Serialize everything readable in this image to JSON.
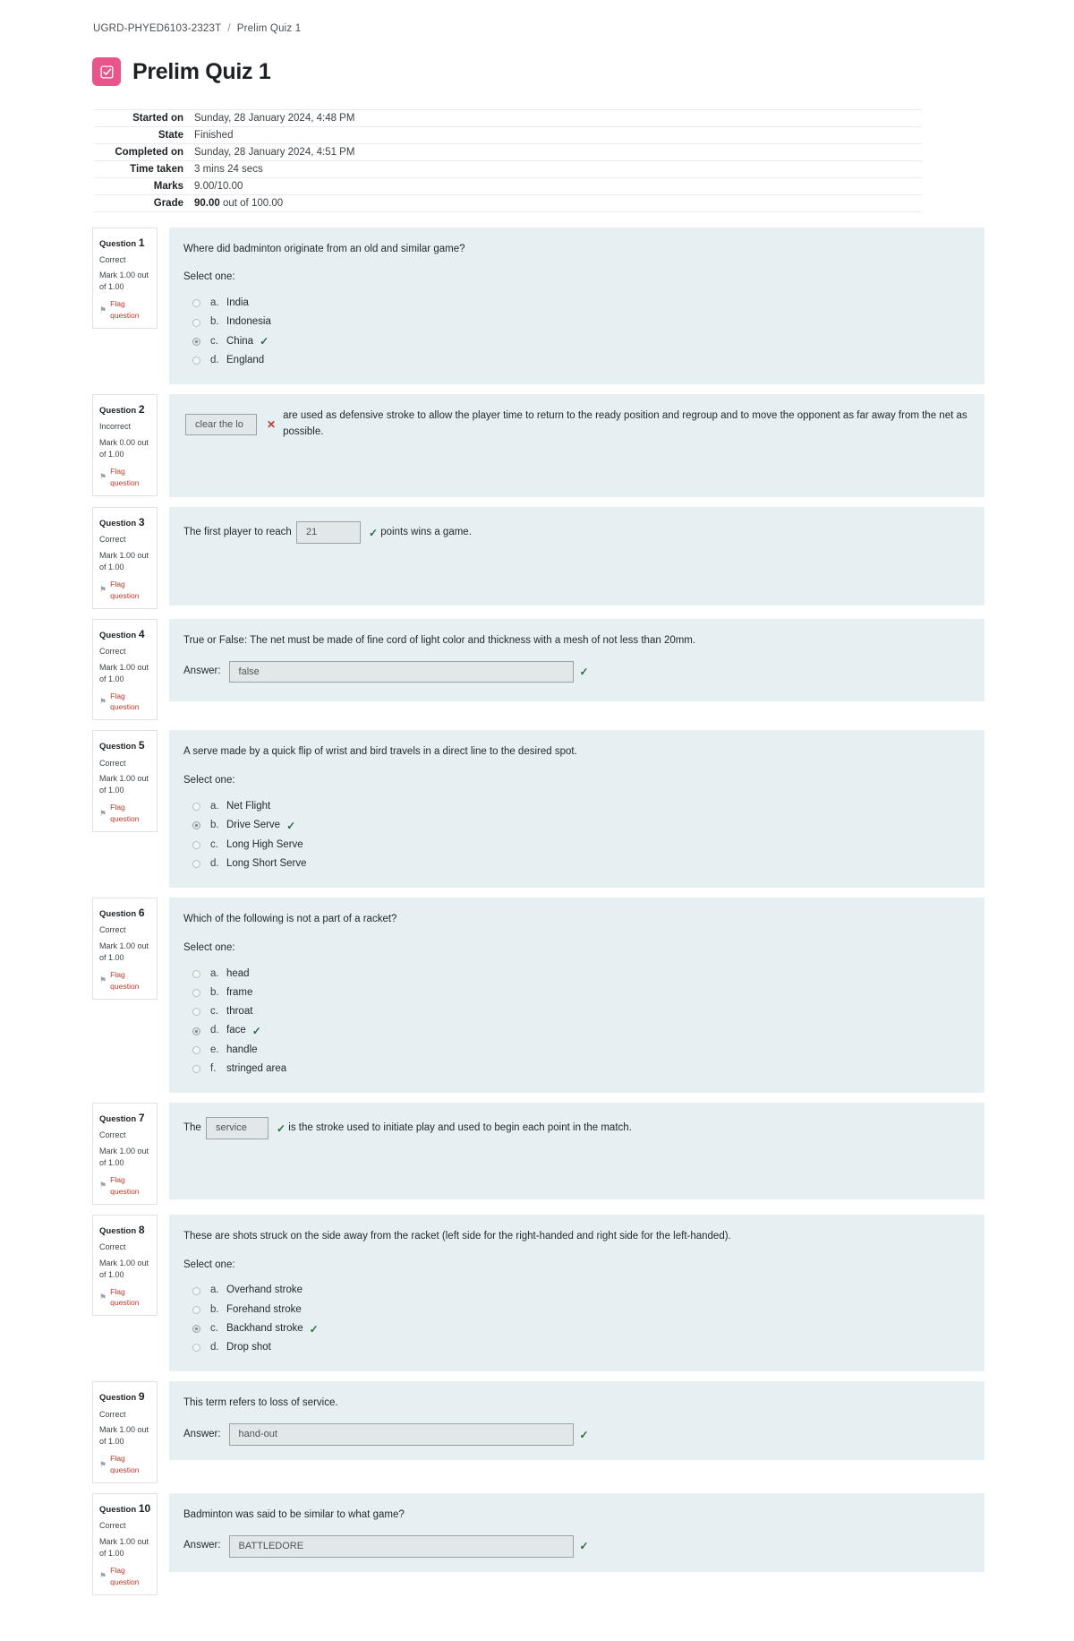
{
  "breadcrumb": {
    "course": "UGRD-PHYED6103-2323T",
    "separator": "/",
    "current": "Prelim Quiz 1"
  },
  "header": {
    "title": "Prelim Quiz 1",
    "icon": "quiz-checkbox-icon"
  },
  "summary": {
    "rows": [
      {
        "label": "Started on",
        "value": "Sunday, 28 January 2024, 4:48 PM"
      },
      {
        "label": "State",
        "value": "Finished"
      },
      {
        "label": "Completed on",
        "value": "Sunday, 28 January 2024, 4:51 PM"
      },
      {
        "label": "Time taken",
        "value": "3 mins 24 secs"
      },
      {
        "label": "Marks",
        "value": "9.00/10.00"
      }
    ],
    "grade": {
      "label": "Grade",
      "value": "90.00",
      "suffix": "out of 100.00"
    }
  },
  "labels": {
    "question_word": "Question",
    "select_one": "Select one:",
    "flag_question": "Flag question",
    "answer_label": "Answer:",
    "correct_mark": "✓",
    "incorrect_mark": "✕",
    "flag_icon": "⚑"
  },
  "colors": {
    "accent_pink": "#e9548c",
    "question_bg": "#e6f0f2",
    "correct_green": "#2e6b3f",
    "incorrect_red": "#c0392b",
    "flag_link": "#c0392b"
  },
  "questions": [
    {
      "number": "1",
      "state": "Correct",
      "mark": "Mark 1.00 out of 1.00",
      "type": "multichoice",
      "text": "Where did badminton originate from an old and similar game?",
      "options": [
        {
          "letter": "a.",
          "text": "India",
          "selected": false,
          "correct": false
        },
        {
          "letter": "b.",
          "text": "Indonesia",
          "selected": false,
          "correct": false
        },
        {
          "letter": "c.",
          "text": "China",
          "selected": true,
          "correct": true
        },
        {
          "letter": "d.",
          "text": "England",
          "selected": false,
          "correct": false
        }
      ]
    },
    {
      "number": "2",
      "state": "Incorrect",
      "mark": "Mark 0.00 out of 1.00",
      "type": "gapfill-lead",
      "field_value": "clear the lo",
      "field_correct": false,
      "text_after": "are used as defensive stroke to allow the player time to return to the ready position and regroup and to move the opponent as far away from the net as possible."
    },
    {
      "number": "3",
      "state": "Correct",
      "mark": "Mark 1.00 out of 1.00",
      "type": "gapfill-mid",
      "text_before": "The first player to reach",
      "field_value": "21",
      "field_correct": true,
      "text_after": "points wins a game."
    },
    {
      "number": "4",
      "state": "Correct",
      "mark": "Mark 1.00 out of 1.00",
      "type": "shortanswer",
      "text": "True or False: The net must be made of fine cord of light color and thickness with a mesh of not less than 20mm.",
      "answer_value": "false",
      "answer_correct": true
    },
    {
      "number": "5",
      "state": "Correct",
      "mark": "Mark 1.00 out of 1.00",
      "type": "multichoice",
      "text": "A serve made by a quick flip of wrist and bird travels in a direct line to the desired spot.",
      "options": [
        {
          "letter": "a.",
          "text": "Net Flight",
          "selected": false,
          "correct": false
        },
        {
          "letter": "b.",
          "text": "Drive Serve",
          "selected": true,
          "correct": true
        },
        {
          "letter": "c.",
          "text": "Long High Serve",
          "selected": false,
          "correct": false
        },
        {
          "letter": "d.",
          "text": "Long Short Serve",
          "selected": false,
          "correct": false
        }
      ]
    },
    {
      "number": "6",
      "state": "Correct",
      "mark": "Mark 1.00 out of 1.00",
      "type": "multichoice",
      "text": "Which of the following is not a part of a racket?",
      "options": [
        {
          "letter": "a.",
          "text": "head",
          "selected": false,
          "correct": false
        },
        {
          "letter": "b.",
          "text": "frame",
          "selected": false,
          "correct": false
        },
        {
          "letter": "c.",
          "text": "throat",
          "selected": false,
          "correct": false
        },
        {
          "letter": "d.",
          "text": "face",
          "selected": true,
          "correct": true
        },
        {
          "letter": "e.",
          "text": "handle",
          "selected": false,
          "correct": false
        },
        {
          "letter": "f.",
          "text": "stringed area",
          "selected": false,
          "correct": false
        }
      ]
    },
    {
      "number": "7",
      "state": "Correct",
      "mark": "Mark 1.00 out of 1.00",
      "type": "gapfill-mid",
      "text_before": "The",
      "field_value": "service",
      "field_correct": true,
      "text_after": "is the stroke used to initiate play and used to begin each point in the match."
    },
    {
      "number": "8",
      "state": "Correct",
      "mark": "Mark 1.00 out of 1.00",
      "type": "multichoice",
      "text": "These are shots struck on the side away from the racket (left side for the right-handed and right side for the left-handed).",
      "options": [
        {
          "letter": "a.",
          "text": "Overhand stroke",
          "selected": false,
          "correct": false
        },
        {
          "letter": "b.",
          "text": "Forehand stroke",
          "selected": false,
          "correct": false
        },
        {
          "letter": "c.",
          "text": "Backhand stroke",
          "selected": true,
          "correct": true
        },
        {
          "letter": "d.",
          "text": "Drop shot",
          "selected": false,
          "correct": false
        }
      ]
    },
    {
      "number": "9",
      "state": "Correct",
      "mark": "Mark 1.00 out of 1.00",
      "type": "shortanswer",
      "text": "This term refers to loss of service.",
      "answer_value": "hand-out",
      "answer_correct": true
    },
    {
      "number": "10",
      "state": "Correct",
      "mark": "Mark 1.00 out of 1.00",
      "type": "shortanswer",
      "text": "Badminton was said to be similar to what game?",
      "answer_value": "BATTLEDORE",
      "answer_correct": true
    }
  ]
}
